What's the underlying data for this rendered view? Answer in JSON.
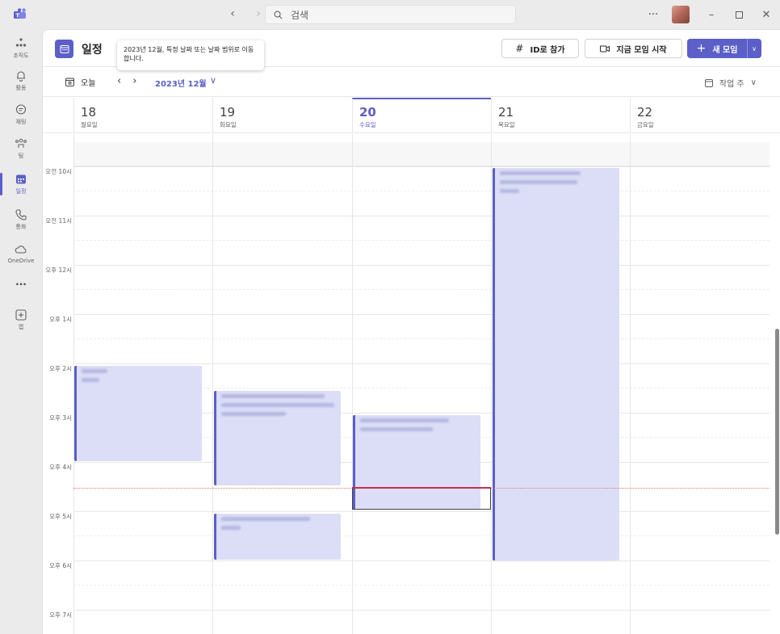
{
  "titlebar": {
    "search_placeholder": "검색",
    "more": "···"
  },
  "rail": {
    "items": [
      {
        "label": "조직도",
        "icon": "org-chart-icon"
      },
      {
        "label": "활동",
        "icon": "bell-icon"
      },
      {
        "label": "채팅",
        "icon": "chat-icon"
      },
      {
        "label": "팀",
        "icon": "teams-icon"
      },
      {
        "label": "일정",
        "icon": "calendar-icon"
      },
      {
        "label": "통화",
        "icon": "phone-icon"
      },
      {
        "label": "OneDrive",
        "icon": "cloud-icon"
      },
      {
        "label": "···",
        "icon": "more-icon"
      },
      {
        "label": "앱",
        "icon": "apps-add-icon"
      }
    ]
  },
  "header": {
    "title": "일정",
    "tooltip": "2023년 12월, 특정 날짜 또는 날짜 범위로 이동합니다.",
    "join_id_label": "ID로 참가",
    "meet_now_label": "지금 모임 시작",
    "new_meeting_label": "새 모임"
  },
  "toolbar": {
    "today_label": "오늘",
    "month_label": "2023년 12월",
    "view_label": "작업 주"
  },
  "days": [
    {
      "num": "18",
      "name": "월요일"
    },
    {
      "num": "19",
      "name": "화요일"
    },
    {
      "num": "20",
      "name": "수요일"
    },
    {
      "num": "21",
      "name": "목요일"
    },
    {
      "num": "22",
      "name": "금요일"
    }
  ],
  "hours": [
    "오전 10시",
    "오전 11시",
    "오후 12시",
    "오후 1시",
    "오후 2시",
    "오후 3시",
    "오후 4시",
    "오후 5시",
    "오후 6시",
    "오후 7시"
  ],
  "colors": {
    "accent": "#5b5fc7",
    "event_bg": "#dcdef7",
    "now": "#c4314b"
  }
}
